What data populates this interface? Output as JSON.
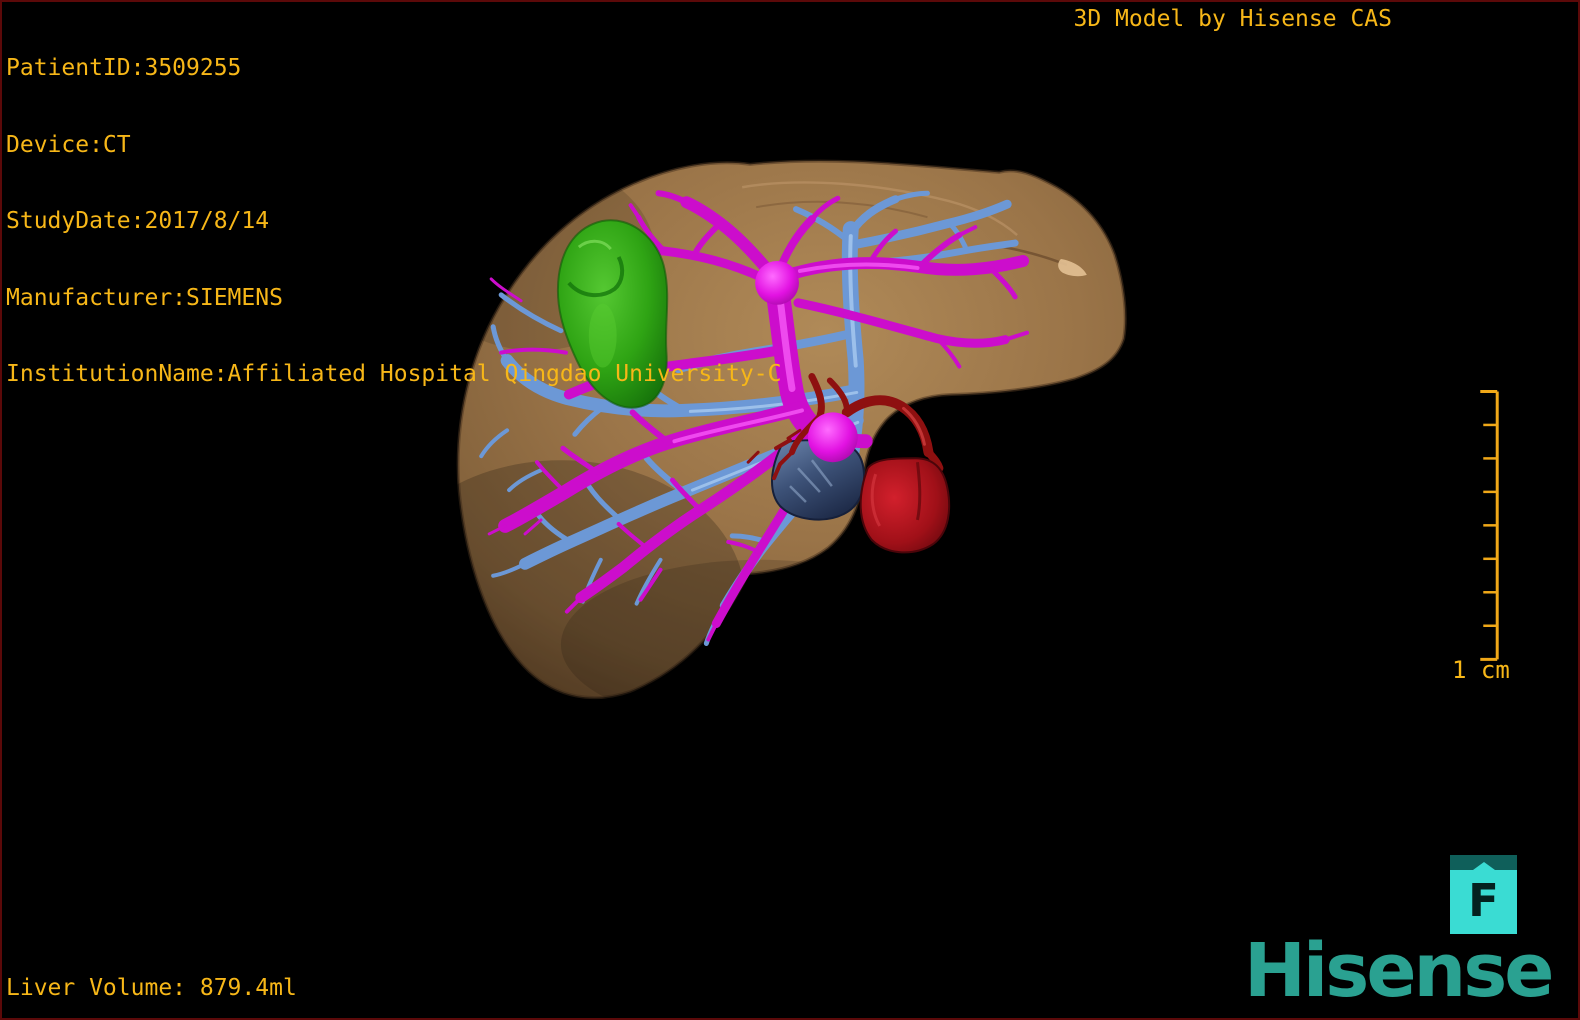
{
  "header": {
    "patient_info": [
      "PatientID:3509255",
      "Device:CT",
      "StudyDate:2017/8/14",
      "Manufacturer:SIEMENS",
      "InstitutionName:Affiliated Hospital Qingdao University-C"
    ],
    "title": "3D Model by Hisense CAS"
  },
  "footer": {
    "liver_volume": "Liver Volume: 879.4ml"
  },
  "scale": {
    "label": "1 cm",
    "divisions": 8
  },
  "marker": {
    "letter": "F"
  },
  "brand": {
    "name": "Hisense",
    "color": "#2AA191"
  },
  "colors": {
    "background": "#000000",
    "frame_border": "#5C0909",
    "annotation_text": "#F7B718",
    "scale_bar": "#F0A818",
    "marker_cyan": "#3ADCD3",
    "marker_header_teal": "#0F5F5A"
  },
  "model": {
    "structures": [
      {
        "name": "liver-surface",
        "color": "#9A7448"
      },
      {
        "name": "green-mass",
        "color": "#2FA414"
      },
      {
        "name": "magenta-vessel-tree",
        "color": "#CC0DCC"
      },
      {
        "name": "blue-vessel-tree",
        "color": "#6C98D6"
      },
      {
        "name": "dark-red-vessels",
        "color": "#8E1010"
      },
      {
        "name": "red-mass",
        "color": "#B01020"
      },
      {
        "name": "navy-mass",
        "color": "#33476B"
      }
    ]
  }
}
